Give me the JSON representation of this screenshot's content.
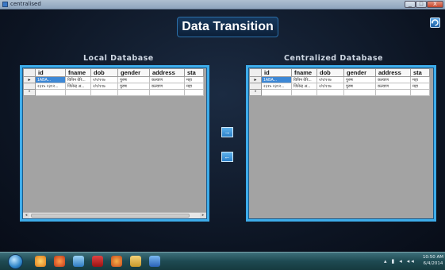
{
  "window": {
    "title": "centralised",
    "min_label": "_",
    "max_label": "□",
    "close_label": "X"
  },
  "header": {
    "title": "Data Transition"
  },
  "local": {
    "label": "Local Database",
    "columns": [
      "",
      "id",
      "fname",
      "dob",
      "gender",
      "address",
      "sta"
    ],
    "rows": [
      {
        "marker": "▸",
        "cells": [
          "1ABA...",
          "विपिन वेरि...",
          "२/१/१९७",
          "पुरुष",
          "कल्याण",
          "महा"
        ]
      },
      {
        "marker": "",
        "cells": [
          "२३१५ २३१२...",
          "जितेन्द्र अ...",
          "२/१/१९७",
          "पुरुष",
          "कल्याण",
          "महा"
        ]
      },
      {
        "marker": "*",
        "cells": [
          "",
          "",
          "",
          "",
          "",
          ""
        ]
      }
    ]
  },
  "central": {
    "label": "Centralized Database",
    "columns": [
      "",
      "id",
      "fname",
      "dob",
      "gender",
      "address",
      "sta"
    ],
    "rows": [
      {
        "marker": "▸",
        "cells": [
          "1ABA...",
          "विपिन वेरि...",
          "२/१/१९७",
          "पुरुष",
          "कल्याण",
          "महा"
        ]
      },
      {
        "marker": "",
        "cells": [
          "२३१५ २३१२...",
          "जितेन्द्र अ...",
          "२/१/१९७",
          "पुरुष",
          "कल्याण",
          "महा"
        ]
      },
      {
        "marker": "*",
        "cells": [
          "",
          "",
          "",
          "",
          "",
          ""
        ]
      }
    ]
  },
  "buttons": {
    "move_right": "→",
    "move_left": "←"
  },
  "scroll": {
    "left_arrow": "◂",
    "right_arrow": "▸"
  },
  "taskbar": {
    "time": "10:50 AM",
    "date": "6/4/2014"
  },
  "colors": {
    "panel_border": "#3dacea",
    "grid_background": "#a3a3a3",
    "selected_cell": "#3d88d6"
  }
}
